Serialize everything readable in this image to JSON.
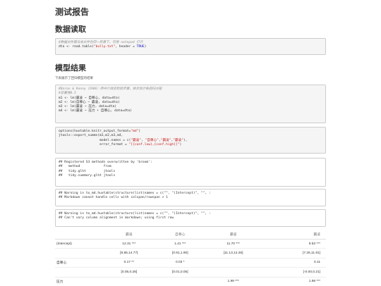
{
  "headings": {
    "main": "测试报告",
    "sec1": "数据读取",
    "sec2": "模型结果"
  },
  "para": "下表展示了回归模型的结果",
  "code1": {
    "comment": "#数据文件需与本文件在同一目录下，可用 notepad 打开",
    "line2_pre": "dta <- read.table(",
    "line2_str": "\"bully.txt\"",
    "line2_mid": ", header = ",
    "line2_kw": "TRUE",
    "line2_post": ")"
  },
  "code2": {
    "comment1": "#Baron & Kenny（1986）的中介效应检验步骤，依次估计各回归方程",
    "comment2": "#显著性0.5",
    "m1": "m1 <- lm(霸凌 ~ 自尊心, data=dta)",
    "m2": "m2 <- lm(自尊心 ~ 霸凌, data=dta)",
    "m3": "m3 <- lm(霸凌 ~ 压力, data=dta)",
    "m4": "m4 <- lm(霸凌 ~ 压力 + 自尊心, data=dta)"
  },
  "code3": {
    "l1_pre": "options(huxtable.knitr_output_format=",
    "l1_str": "\"md\"",
    "l1_post": ")",
    "l2": "jtools::export_summs(m1,m2,m3,m4,",
    "l3_pre": "                     model.names = c(",
    "l3_s1": "\"霸凌\"",
    "l3_s2": "\"自尊心\"",
    "l3_s3": "\"霸凌\"",
    "l3_s4": "\"霸凌\"",
    "l3_post": "),",
    "l4_pre": "                     error_format = ",
    "l4_str": "\"[{conf.low},{conf.high}]\"",
    "l4_post": ")"
  },
  "output1": [
    "## Registered S3 methods overwritten by 'broom':",
    "##   method            from",
    "##   tidy.glht         jtools",
    "##   tidy.summary.glht jtools"
  ],
  "output2": [
    "## Warning in to_md.huxtable(structure(list(names = c(\"\", \"(Intercept)\", \"\", :",
    "## Markdown cannot handle cells with colspan/rowspan > 1"
  ],
  "output3": [
    "## Warning in to_md.huxtable(structure(list(names = c(\"\", \"(Intercept)\", \"\", :",
    "## Can't vary column alignment in markdown; using first row"
  ],
  "table": {
    "headers": [
      "",
      "霸凌",
      "自尊心",
      "霸凌",
      "霸凌"
    ],
    "rows": [
      [
        "(Intercept)",
        "12.31 ***",
        "1.41 ***",
        "11.70 ***",
        "9.53 ***"
      ],
      [
        "",
        "[9.85,14.77]",
        "[0.91,1.90]",
        "[11.13,12.26]",
        "[7.26,11.81]"
      ],
      [
        "自尊心",
        "0.17 **",
        "0.03 *",
        "",
        "0.11"
      ],
      [
        "",
        "[0.05,0.28]",
        "[0.01,0.05]",
        "",
        "[-0.00,0.21]"
      ],
      [
        "压力",
        "",
        "",
        "1.99 ***",
        "1.98 ***"
      ]
    ]
  }
}
